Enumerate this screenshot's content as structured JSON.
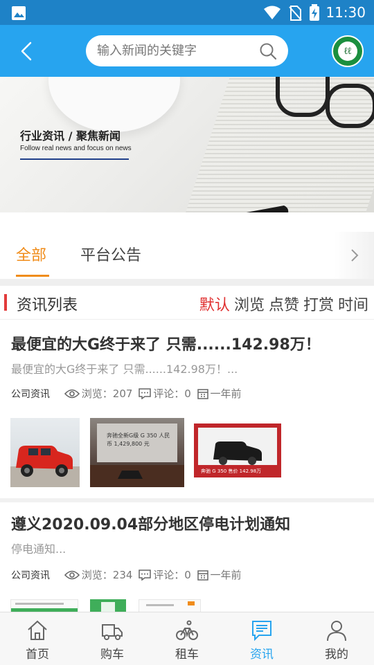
{
  "status_bar": {
    "time": "11:30"
  },
  "header": {
    "search_placeholder": "输入新闻的关键字"
  },
  "banner": {
    "title": "行业资讯 / 聚焦新闻",
    "subtitle": "Follow real news and focus on news"
  },
  "tabs": [
    {
      "label": "全部",
      "active": true
    },
    {
      "label": "平台公告",
      "active": false
    }
  ],
  "list_header": {
    "title": "资讯列表",
    "sorts": [
      {
        "label": "默认",
        "active": true
      },
      {
        "label": "浏览",
        "active": false
      },
      {
        "label": "点赞",
        "active": false
      },
      {
        "label": "打赏",
        "active": false
      },
      {
        "label": "时间",
        "active": false
      }
    ]
  },
  "news": [
    {
      "title": "最便宜的大G终于来了 只需......142.98万！",
      "summary": "最便宜的大G终于来了 只需......142.98万！...",
      "category": "公司资讯",
      "views": "浏览：207",
      "comments": "评论：0",
      "time": "一年前",
      "thumbs": [
        {
          "caption": ""
        },
        {
          "caption": "奔驰全新G级 G 350 人民币 1,429,800 元"
        },
        {
          "caption": "奔驰 G 350  售价 142.98万"
        }
      ]
    },
    {
      "title": "遵义2020.09.04部分地区停电计划通知",
      "summary": "停电通知...",
      "category": "公司资讯",
      "views": "浏览：234",
      "comments": "评论：0",
      "time": "一年前"
    }
  ],
  "bottom_nav": [
    {
      "label": "首页",
      "icon": "home-icon",
      "active": false
    },
    {
      "label": "购车",
      "icon": "truck-icon",
      "active": false
    },
    {
      "label": "租车",
      "icon": "bicycle-icon",
      "active": false
    },
    {
      "label": "资讯",
      "icon": "news-icon",
      "active": true
    },
    {
      "label": "我的",
      "icon": "user-icon",
      "active": false
    }
  ],
  "colors": {
    "header": "#27a4ef",
    "status_bar": "#1e82c7",
    "tab_active": "#f08c1a",
    "sort_active": "#e03030",
    "nav_active": "#27a4ef"
  }
}
